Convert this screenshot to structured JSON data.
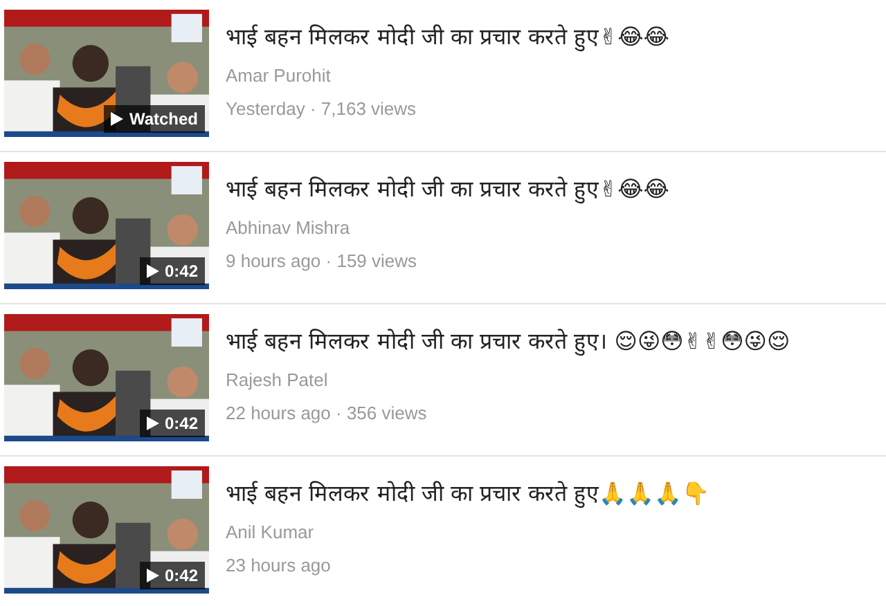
{
  "videos": [
    {
      "title": "भाई बहन मिलकर मोदी जी का प्रचार करते हुए✌😂😂",
      "author": "Amar Purohit",
      "meta": "Yesterday · 7,163 views",
      "badge": "Watched"
    },
    {
      "title": "भाई बहन मिलकर मोदी जी का प्रचार करते हुए✌😂😂",
      "author": "Abhinav Mishra",
      "meta": "9 hours ago · 159 views",
      "badge": "0:42"
    },
    {
      "title": "भाई बहन मिलकर मोदी जी का प्रचार करते हुए। 😌😜😳✌✌😳😜😌",
      "author": "Rajesh Patel",
      "meta": "22 hours ago · 356 views",
      "badge": "0:42"
    },
    {
      "title": "भाई बहन मिलकर मोदी जी का प्रचार करते हुए🙏🙏🙏👇",
      "author": "Anil Kumar",
      "meta": "23 hours ago",
      "badge": "0:42"
    }
  ]
}
